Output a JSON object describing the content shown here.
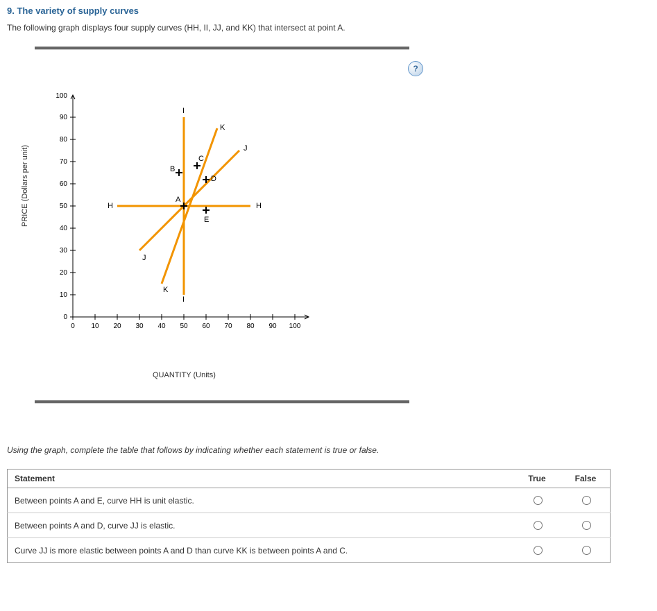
{
  "question": {
    "number": "9.",
    "title": "The variety of supply curves",
    "intro": "The following graph displays four supply curves (HH, II, JJ, and KK) that intersect at point A."
  },
  "help_icon": "?",
  "chart_data": {
    "type": "line",
    "xlabel": "QUANTITY (Units)",
    "ylabel": "PRICE (Dollars per unit)",
    "xlim": [
      0,
      100
    ],
    "ylim": [
      0,
      100
    ],
    "xticks": [
      0,
      10,
      20,
      30,
      40,
      50,
      60,
      70,
      80,
      90,
      100
    ],
    "yticks": [
      0,
      10,
      20,
      30,
      40,
      50,
      60,
      70,
      80,
      90,
      100
    ],
    "series": [
      {
        "name": "H",
        "points": [
          [
            20,
            50
          ],
          [
            80,
            50
          ]
        ],
        "label_left": "H",
        "label_right": "H"
      },
      {
        "name": "I",
        "points": [
          [
            50,
            10
          ],
          [
            50,
            90
          ]
        ],
        "label_top": "I",
        "label_bottom": "I"
      },
      {
        "name": "J",
        "points": [
          [
            30,
            30
          ],
          [
            75,
            75
          ]
        ],
        "label_tr": "J",
        "label_bl": "J"
      },
      {
        "name": "K",
        "points": [
          [
            40,
            15
          ],
          [
            65,
            85
          ]
        ],
        "label_top": "K",
        "label_bottom": "K"
      }
    ],
    "marked_points": {
      "A": {
        "x": 50,
        "y": 50
      },
      "B": {
        "x": 48,
        "y": 65
      },
      "C": {
        "x": 56,
        "y": 68
      },
      "D": {
        "x": 60,
        "y": 62
      },
      "E": {
        "x": 60,
        "y": 48
      }
    }
  },
  "instruction": "Using the graph, complete the table that follows by indicating whether each statement is true or false.",
  "table": {
    "headers": [
      "Statement",
      "True",
      "False"
    ],
    "rows": [
      {
        "statement": "Between points A and E, curve HH is unit elastic."
      },
      {
        "statement": "Between points A and D, curve JJ is elastic."
      },
      {
        "statement": "Curve JJ is more elastic between points A and D than curve KK is between points A and C."
      }
    ]
  }
}
